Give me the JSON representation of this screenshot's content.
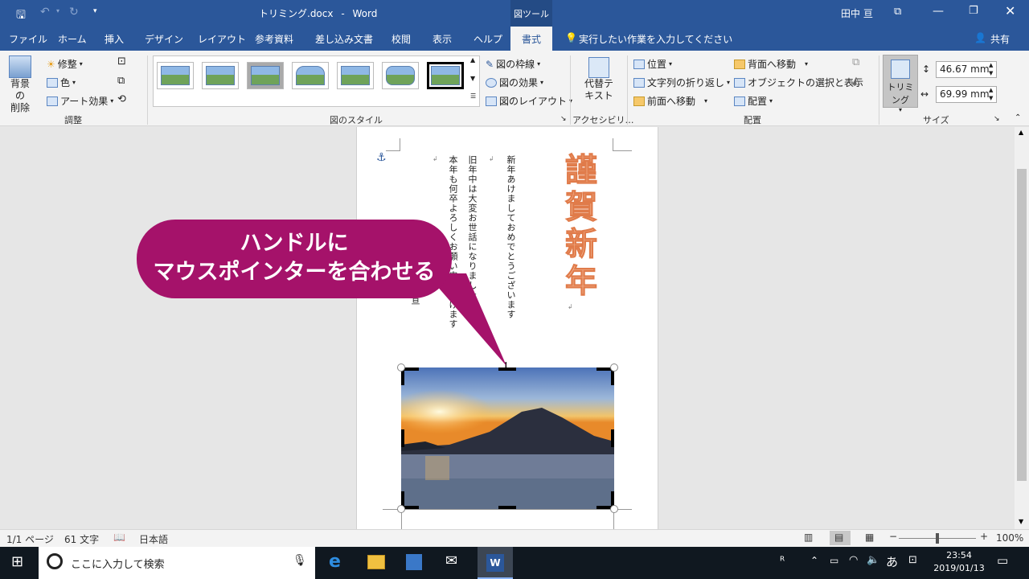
{
  "titlebar": {
    "filename": "トリミング.docx",
    "separator": "-",
    "app": "Word",
    "tool_context": "図ツール",
    "user": "田中 亘"
  },
  "tabs": [
    "ファイル",
    "ホーム",
    "挿入",
    "デザイン",
    "レイアウト",
    "参考資料",
    "差し込み文書",
    "校閲",
    "表示",
    "ヘルプ"
  ],
  "active_tab": "書式",
  "tell_me": "実行したい作業を入力してください",
  "share": "共有",
  "ribbon": {
    "remove_bg": [
      "背景の",
      "削除"
    ],
    "corrections": "修整",
    "color": "色",
    "artistic": "アート効果",
    "adjust_group": "調整",
    "picture_styles_group": "図のスタイル",
    "border": "図の枠線",
    "effects": "図の効果",
    "layout": "図のレイアウト",
    "alt_text": [
      "代替テ",
      "キスト"
    ],
    "accessibility_group": "アクセシビリ…",
    "position": "位置",
    "wrap_text": "文字列の折り返し",
    "bring_forward": "前面へ移動",
    "send_backward": "背面へ移動",
    "selection_pane": "オブジェクトの選択と表示",
    "align": "配置",
    "arrange_group": "配置",
    "crop": "トリミング",
    "height": "46.67 mm",
    "width": "69.99 mm",
    "size_group": "サイズ"
  },
  "document": {
    "title": "謹賀新年",
    "line1": "新年あけましておめでとうございます",
    "line2": "旧年中は大変お世話になりました",
    "line3": "本年も何卒よろしくお願い申し上げます",
    "line4": "亘"
  },
  "callout": {
    "line1": "ハンドルに",
    "line2": "マウスポインターを合わせる"
  },
  "status": {
    "page": "1/1 ページ",
    "words": "61 文字",
    "language": "日本語",
    "zoom": "100%"
  },
  "taskbar": {
    "search": "ここに入力して検索",
    "ime": "あ",
    "time": "23:54",
    "date": "2019/01/13"
  }
}
